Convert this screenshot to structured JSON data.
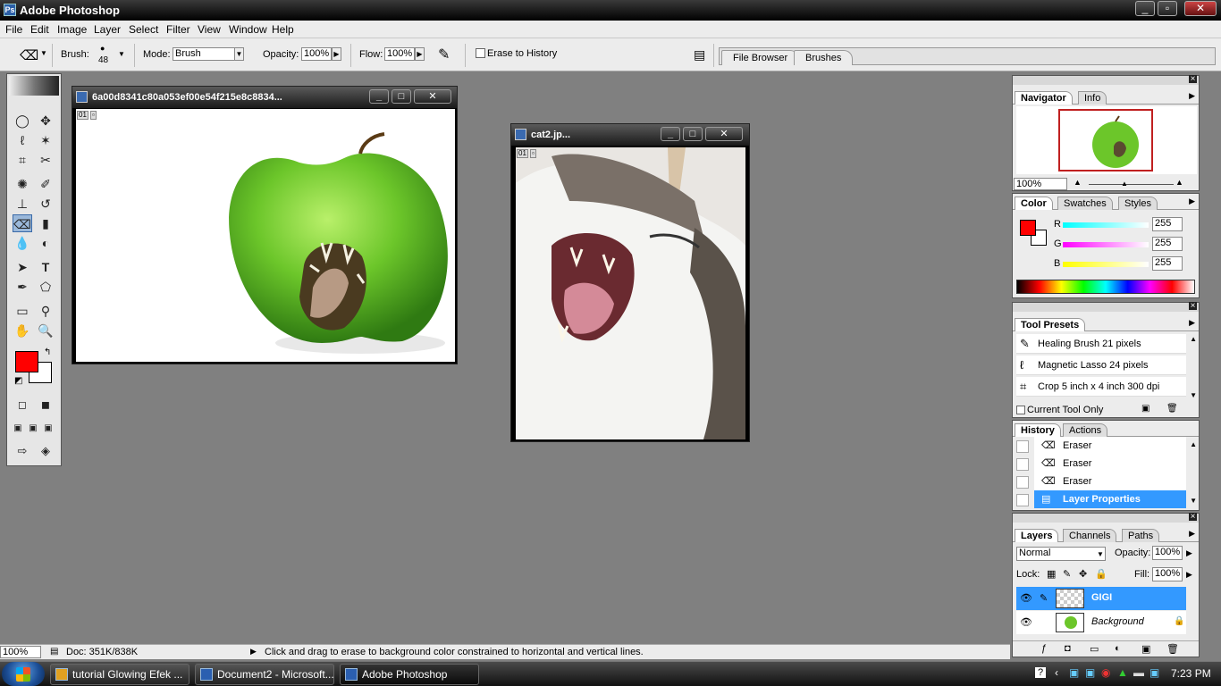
{
  "app": {
    "title": "Adobe Photoshop"
  },
  "window_controls": {
    "minimize": "_",
    "restore": "▫",
    "close": "✕"
  },
  "menu": [
    "File",
    "Edit",
    "Image",
    "Layer",
    "Select",
    "Filter",
    "View",
    "Window",
    "Help"
  ],
  "options": {
    "brush_label": "Brush:",
    "brush_size": "48",
    "mode_label": "Mode:",
    "mode_value": "Brush",
    "opacity_label": "Opacity:",
    "opacity_value": "100%",
    "flow_label": "Flow:",
    "flow_value": "100%",
    "erase_history_label": "Erase to History"
  },
  "well_tabs": [
    "File Browser",
    "Brushes"
  ],
  "doc1": {
    "title": "6a00d8341c80a053ef00e54f215e8c8834...",
    "badge": "01"
  },
  "doc2": {
    "title": "cat2.jp...",
    "badge": "01"
  },
  "navigator": {
    "tabs": [
      "Navigator",
      "Info"
    ],
    "zoom": "100%"
  },
  "color": {
    "tabs": [
      "Color",
      "Swatches",
      "Styles"
    ],
    "r_label": "R",
    "g_label": "G",
    "b_label": "B",
    "r": "255",
    "g": "255",
    "b": "255",
    "foreground": "#ff0000",
    "background": "#ffffff"
  },
  "tool_presets": {
    "title": "Tool Presets",
    "items": [
      "Healing Brush 21 pixels",
      "Magnetic Lasso 24 pixels",
      "Crop 5 inch x 4 inch 300 dpi"
    ],
    "current_only": "Current Tool Only"
  },
  "history": {
    "tabs": [
      "History",
      "Actions"
    ],
    "items": [
      "Eraser",
      "Eraser",
      "Eraser",
      "Layer Properties"
    ]
  },
  "layers": {
    "tabs": [
      "Layers",
      "Channels",
      "Paths"
    ],
    "blend": "Normal",
    "opacity_label": "Opacity:",
    "opacity": "100%",
    "lock_label": "Lock:",
    "fill_label": "Fill:",
    "fill": "100%",
    "items": [
      "GIGI",
      "Background"
    ]
  },
  "status": {
    "zoom": "100%",
    "doc": "Doc: 351K/838K",
    "hint": "Click and drag to erase to background color constrained to horizontal and vertical lines."
  },
  "taskbar": {
    "items": [
      "tutorial Glowing Efek ...",
      "Document2 - Microsoft...",
      "Adobe Photoshop"
    ],
    "clock": "7:23 PM"
  }
}
